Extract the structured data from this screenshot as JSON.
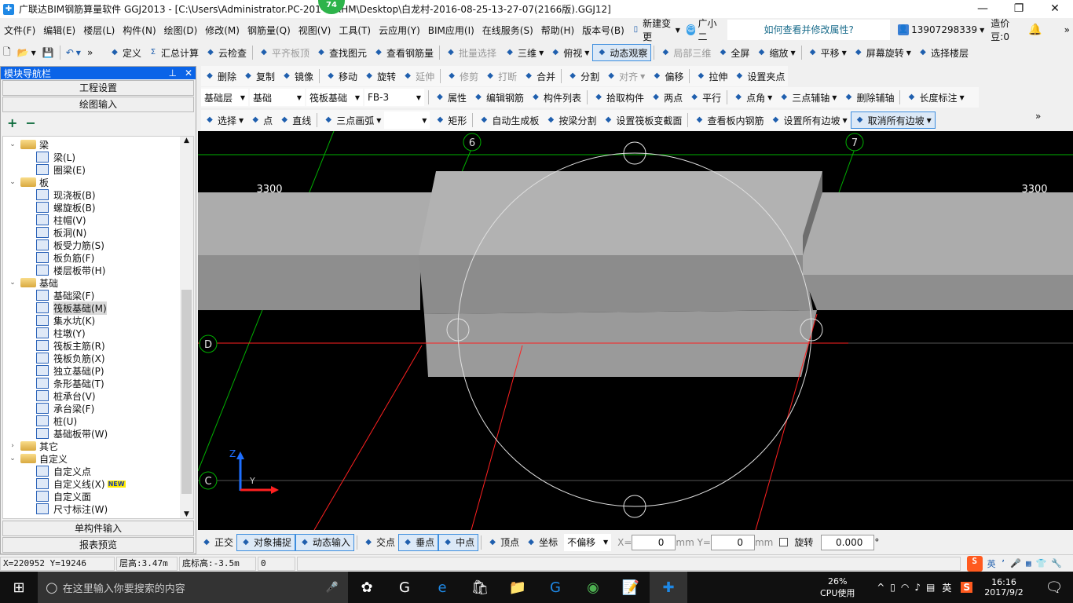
{
  "titlebar": {
    "title": "广联达BIM钢筋算量软件 GGJ2013 - [C:\\Users\\Administrator.PC-201-    NRHM\\Desktop\\白龙村-2016-08-25-13-27-07(2166版).GGJ12]",
    "badge": "74",
    "min": "—",
    "max": "❐",
    "close": "✕"
  },
  "menubar": {
    "items": [
      "文件(F)",
      "编辑(E)",
      "楼层(L)",
      "构件(N)",
      "绘图(D)",
      "修改(M)",
      "钢筋量(Q)",
      "视图(V)",
      "工具(T)",
      "云应用(Y)",
      "BIM应用(I)",
      "在线服务(S)",
      "帮助(H)",
      "版本号(B)"
    ],
    "new_change": "新建变更",
    "assistant": "广小二",
    "help_question": "如何查看并修改属性?",
    "account": "13907298339",
    "beans": "造价豆:0",
    "more": "»"
  },
  "toolbar1": {
    "items": [
      {
        "label": "定义"
      },
      {
        "label": "汇总计算",
        "icon": "Σ"
      },
      {
        "label": "云检查"
      },
      {
        "label": "平齐板顶",
        "disabled": true
      },
      {
        "label": "查找图元"
      },
      {
        "label": "查看钢筋量"
      },
      {
        "label": "批量选择",
        "disabled": true
      }
    ],
    "view_items": [
      {
        "label": "三维",
        "dd": true
      },
      {
        "label": "俯视",
        "dd": true
      },
      {
        "label": "动态观察",
        "active": true
      },
      {
        "label": "局部三维",
        "disabled": true
      },
      {
        "label": "全屏"
      },
      {
        "label": "缩放",
        "dd": true
      },
      {
        "label": "平移",
        "dd": true
      },
      {
        "label": "屏幕旋转",
        "dd": true
      },
      {
        "label": "选择楼层"
      }
    ]
  },
  "edit_toolbar": {
    "items": [
      {
        "label": "删除"
      },
      {
        "label": "复制"
      },
      {
        "label": "镜像"
      },
      {
        "label": "移动"
      },
      {
        "label": "旋转"
      },
      {
        "label": "延伸",
        "disabled": true
      },
      {
        "label": "修剪",
        "disabled": true
      },
      {
        "label": "打断",
        "disabled": true
      },
      {
        "label": "合并"
      },
      {
        "label": "分割"
      },
      {
        "label": "对齐",
        "disabled": true,
        "dd": true
      },
      {
        "label": "偏移"
      },
      {
        "label": "拉伸"
      },
      {
        "label": "设置夹点"
      }
    ]
  },
  "selector_toolbar": {
    "floor": "基础层",
    "category": "基础",
    "type": "筏板基础",
    "component": "FB-3",
    "items": [
      {
        "label": "属性"
      },
      {
        "label": "编辑钢筋"
      },
      {
        "label": "构件列表"
      },
      {
        "label": "拾取构件"
      },
      {
        "label": "两点"
      },
      {
        "label": "平行"
      },
      {
        "label": "点角",
        "dd": true
      },
      {
        "label": "三点辅轴",
        "dd": true
      },
      {
        "label": "删除辅轴"
      },
      {
        "label": "长度标注",
        "dd": true
      }
    ]
  },
  "draw_toolbar": {
    "items": [
      {
        "label": "选择",
        "dd": true
      },
      {
        "label": "点"
      },
      {
        "label": "直线"
      },
      {
        "label": "三点画弧",
        "dd": true
      },
      {
        "label": "",
        "blank": true
      },
      {
        "label": "矩形"
      },
      {
        "label": "自动生成板"
      },
      {
        "label": "按梁分割"
      },
      {
        "label": "设置筏板变截面"
      },
      {
        "label": "查看板内钢筋"
      },
      {
        "label": "设置所有边坡",
        "dd": true
      },
      {
        "label": "取消所有边坡",
        "active": true,
        "dd": true
      }
    ]
  },
  "navigator": {
    "title": "模块导航栏",
    "pin": "📌",
    "close": "✕",
    "project_settings": "工程设置",
    "drawing_input": "绘图输入",
    "single_input": "单构件输入",
    "report_preview": "报表预览",
    "expand": "+",
    "collapse": "−",
    "tree": [
      {
        "label": "梁",
        "level": 0,
        "folder": true,
        "open": true
      },
      {
        "label": "梁(L)",
        "level": 1
      },
      {
        "label": "圈梁(E)",
        "level": 1
      },
      {
        "label": "板",
        "level": 0,
        "folder": true,
        "open": true
      },
      {
        "label": "现浇板(B)",
        "level": 1
      },
      {
        "label": "螺旋板(B)",
        "level": 1
      },
      {
        "label": "柱帽(V)",
        "level": 1
      },
      {
        "label": "板洞(N)",
        "level": 1
      },
      {
        "label": "板受力筋(S)",
        "level": 1
      },
      {
        "label": "板负筋(F)",
        "level": 1
      },
      {
        "label": "楼层板带(H)",
        "level": 1
      },
      {
        "label": "基础",
        "level": 0,
        "folder": true,
        "open": true
      },
      {
        "label": "基础梁(F)",
        "level": 1
      },
      {
        "label": "筏板基础(M)",
        "level": 1,
        "selected": true
      },
      {
        "label": "集水坑(K)",
        "level": 1
      },
      {
        "label": "柱墩(Y)",
        "level": 1
      },
      {
        "label": "筏板主筋(R)",
        "level": 1
      },
      {
        "label": "筏板负筋(X)",
        "level": 1
      },
      {
        "label": "独立基础(P)",
        "level": 1
      },
      {
        "label": "条形基础(T)",
        "level": 1
      },
      {
        "label": "桩承台(V)",
        "level": 1
      },
      {
        "label": "承台梁(F)",
        "level": 1
      },
      {
        "label": "桩(U)",
        "level": 1
      },
      {
        "label": "基础板带(W)",
        "level": 1
      },
      {
        "label": "其它",
        "level": 0,
        "folder": true,
        "open": false
      },
      {
        "label": "自定义",
        "level": 0,
        "folder": true,
        "open": true
      },
      {
        "label": "自定义点",
        "level": 1
      },
      {
        "label": "自定义线(X)",
        "level": 1,
        "new": "NEW"
      },
      {
        "label": "自定义面",
        "level": 1
      },
      {
        "label": "尺寸标注(W)",
        "level": 1
      }
    ]
  },
  "canvas": {
    "axis_labels": [
      "6",
      "7",
      "D",
      "C"
    ],
    "dimensions": [
      "3300",
      "3300"
    ],
    "coord_axes": {
      "z": "Z",
      "y": "Y"
    },
    "colors": {
      "background": "#000000",
      "grid": "#00c000",
      "red_line": "#ff2020",
      "slab": "#a9a9a9"
    }
  },
  "bottom_toolbar": {
    "items": [
      {
        "label": "正交"
      },
      {
        "label": "对象捕捉",
        "active": true
      },
      {
        "label": "动态输入",
        "active": true
      },
      {
        "label": "交点"
      },
      {
        "label": "垂点",
        "active": true
      },
      {
        "label": "中点",
        "active": true
      },
      {
        "label": "顶点"
      },
      {
        "label": "坐标"
      }
    ],
    "offset_mode": "不偏移",
    "x_label": "X=",
    "x_value": "0",
    "y_label": "mm Y=",
    "y_value": "0",
    "unit": "mm",
    "rotate_label": "旋转",
    "rotate_value": "0.000",
    "degree": "°"
  },
  "statusbar": {
    "coords": "X=220952 Y=19246",
    "floor_height": "层高:3.47m",
    "bottom_elev": "底标高:-3.5m",
    "value": "0",
    "ime": "英"
  },
  "taskbar": {
    "search_placeholder": "在这里输入你要搜索的内容",
    "cpu_percent": "26%",
    "cpu_label": "CPU使用",
    "ime": "英",
    "time": "16:16",
    "date": "2017/9/2"
  }
}
